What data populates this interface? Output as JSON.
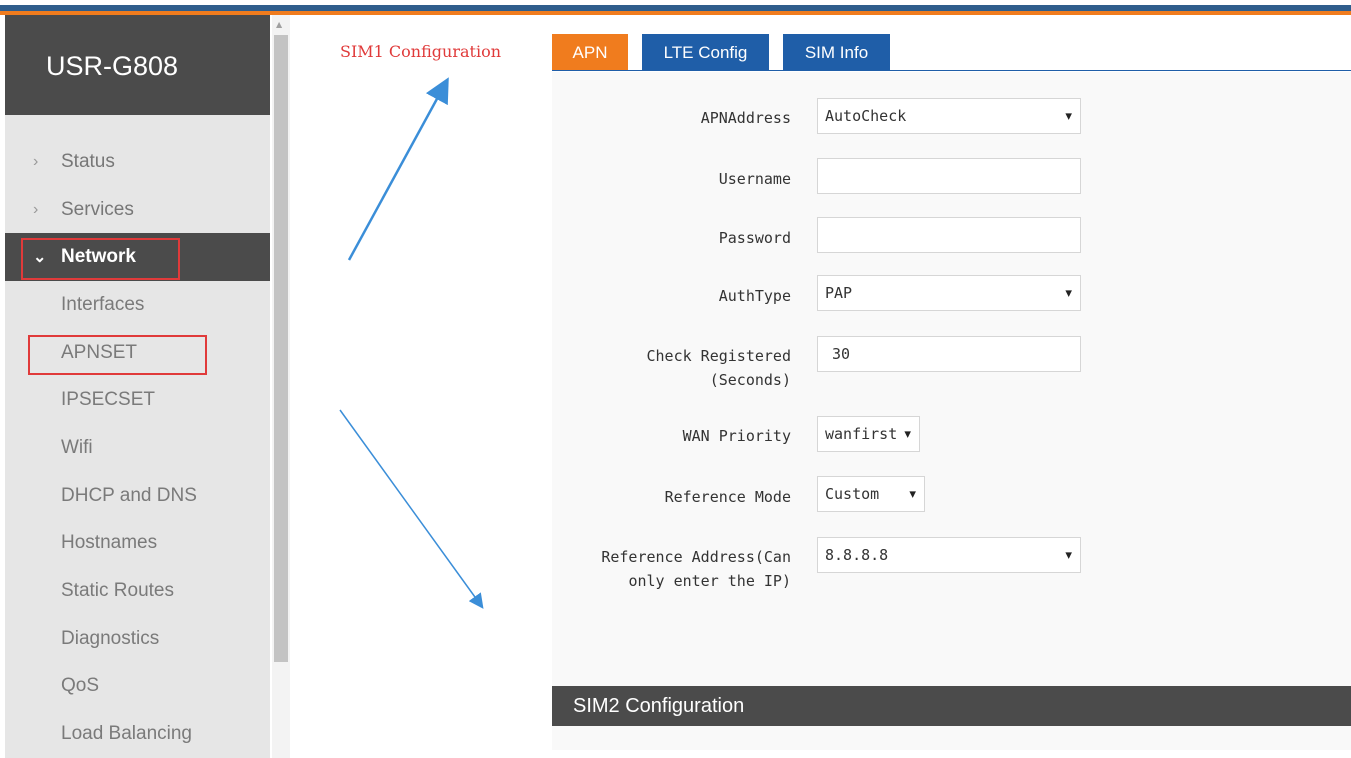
{
  "brand": "USR-G808",
  "nav": {
    "items": [
      {
        "label": "Status",
        "type": "top"
      },
      {
        "label": "Services",
        "type": "top"
      },
      {
        "label": "Network",
        "type": "active"
      },
      {
        "label": "Interfaces",
        "type": "sub"
      },
      {
        "label": "APNSET",
        "type": "sub"
      },
      {
        "label": "IPSECSET",
        "type": "sub"
      },
      {
        "label": "Wifi",
        "type": "sub"
      },
      {
        "label": "DHCP and DNS",
        "type": "sub"
      },
      {
        "label": "Hostnames",
        "type": "sub"
      },
      {
        "label": "Static Routes",
        "type": "sub"
      },
      {
        "label": "Diagnostics",
        "type": "sub"
      },
      {
        "label": "QoS",
        "type": "sub"
      },
      {
        "label": "Load Balancing",
        "type": "sub"
      }
    ]
  },
  "annotation": {
    "sim1_label": "SIM1 Configuration"
  },
  "tabs": {
    "apn": "APN",
    "lte": "LTE Config",
    "sim": "SIM Info"
  },
  "form": {
    "apn_address": {
      "label": "APNAddress",
      "value": "AutoCheck"
    },
    "username": {
      "label": "Username",
      "value": ""
    },
    "password": {
      "label": "Password",
      "value": ""
    },
    "auth_type": {
      "label": "AuthType",
      "value": "PAP"
    },
    "check_registered": {
      "label_line1": "Check Registered",
      "label_line2": "(Seconds)",
      "value": "30"
    },
    "wan_priority": {
      "label": "WAN Priority",
      "value": "wanfirst"
    },
    "reference_mode": {
      "label": "Reference Mode",
      "value": "Custom"
    },
    "reference_address": {
      "label_line1": "Reference Address(Can",
      "label_line2": "only enter the IP)",
      "value": "8.8.8.8"
    }
  },
  "sim2": {
    "title": "SIM2 Configuration"
  },
  "colors": {
    "accent_orange": "#f07c1e",
    "tab_blue": "#1f5ea8",
    "highlight_red": "#e03a3a",
    "arrow_blue": "#3b8ed8",
    "dark_bar": "#4b4b4b"
  }
}
